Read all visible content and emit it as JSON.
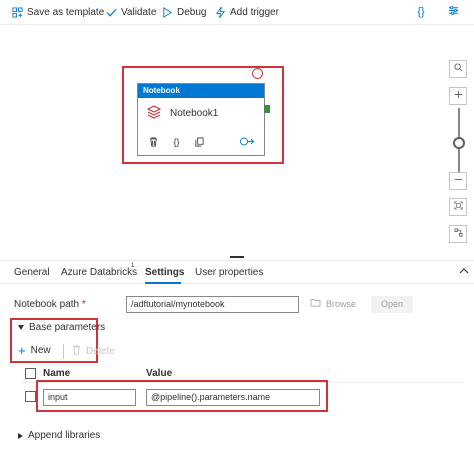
{
  "toolbar": {
    "save_template": "Save as template",
    "validate": "Validate",
    "debug": "Debug",
    "add_trigger": "Add trigger",
    "code_glyph": "{}"
  },
  "node": {
    "type_label": "Notebook",
    "name": "Notebook1",
    "header_color": "#0078d4",
    "highlight_color": "#d13438"
  },
  "tabs": [
    {
      "label": "General"
    },
    {
      "label": "Azure Databricks",
      "badge": "1"
    },
    {
      "label": "Settings",
      "active": true
    },
    {
      "label": "User properties"
    }
  ],
  "settings": {
    "notebook_path_label": "Notebook path",
    "required_mark": "*",
    "notebook_path_value": "/adftutorial/mynotebook",
    "browse_label": "Browse",
    "open_label": "Open"
  },
  "base_parameters": {
    "section_label": "Base parameters",
    "new_label": "New",
    "delete_label": "Delete",
    "columns": [
      "Name",
      "Value"
    ],
    "rows": [
      {
        "name": "input",
        "value": "@pipeline().parameters.name"
      }
    ]
  },
  "append_libraries": {
    "label": "Append libraries"
  },
  "icons": {
    "save_template": "template-icon",
    "validate": "checkmark-icon",
    "debug": "play-icon",
    "add_trigger": "lightning-icon"
  }
}
